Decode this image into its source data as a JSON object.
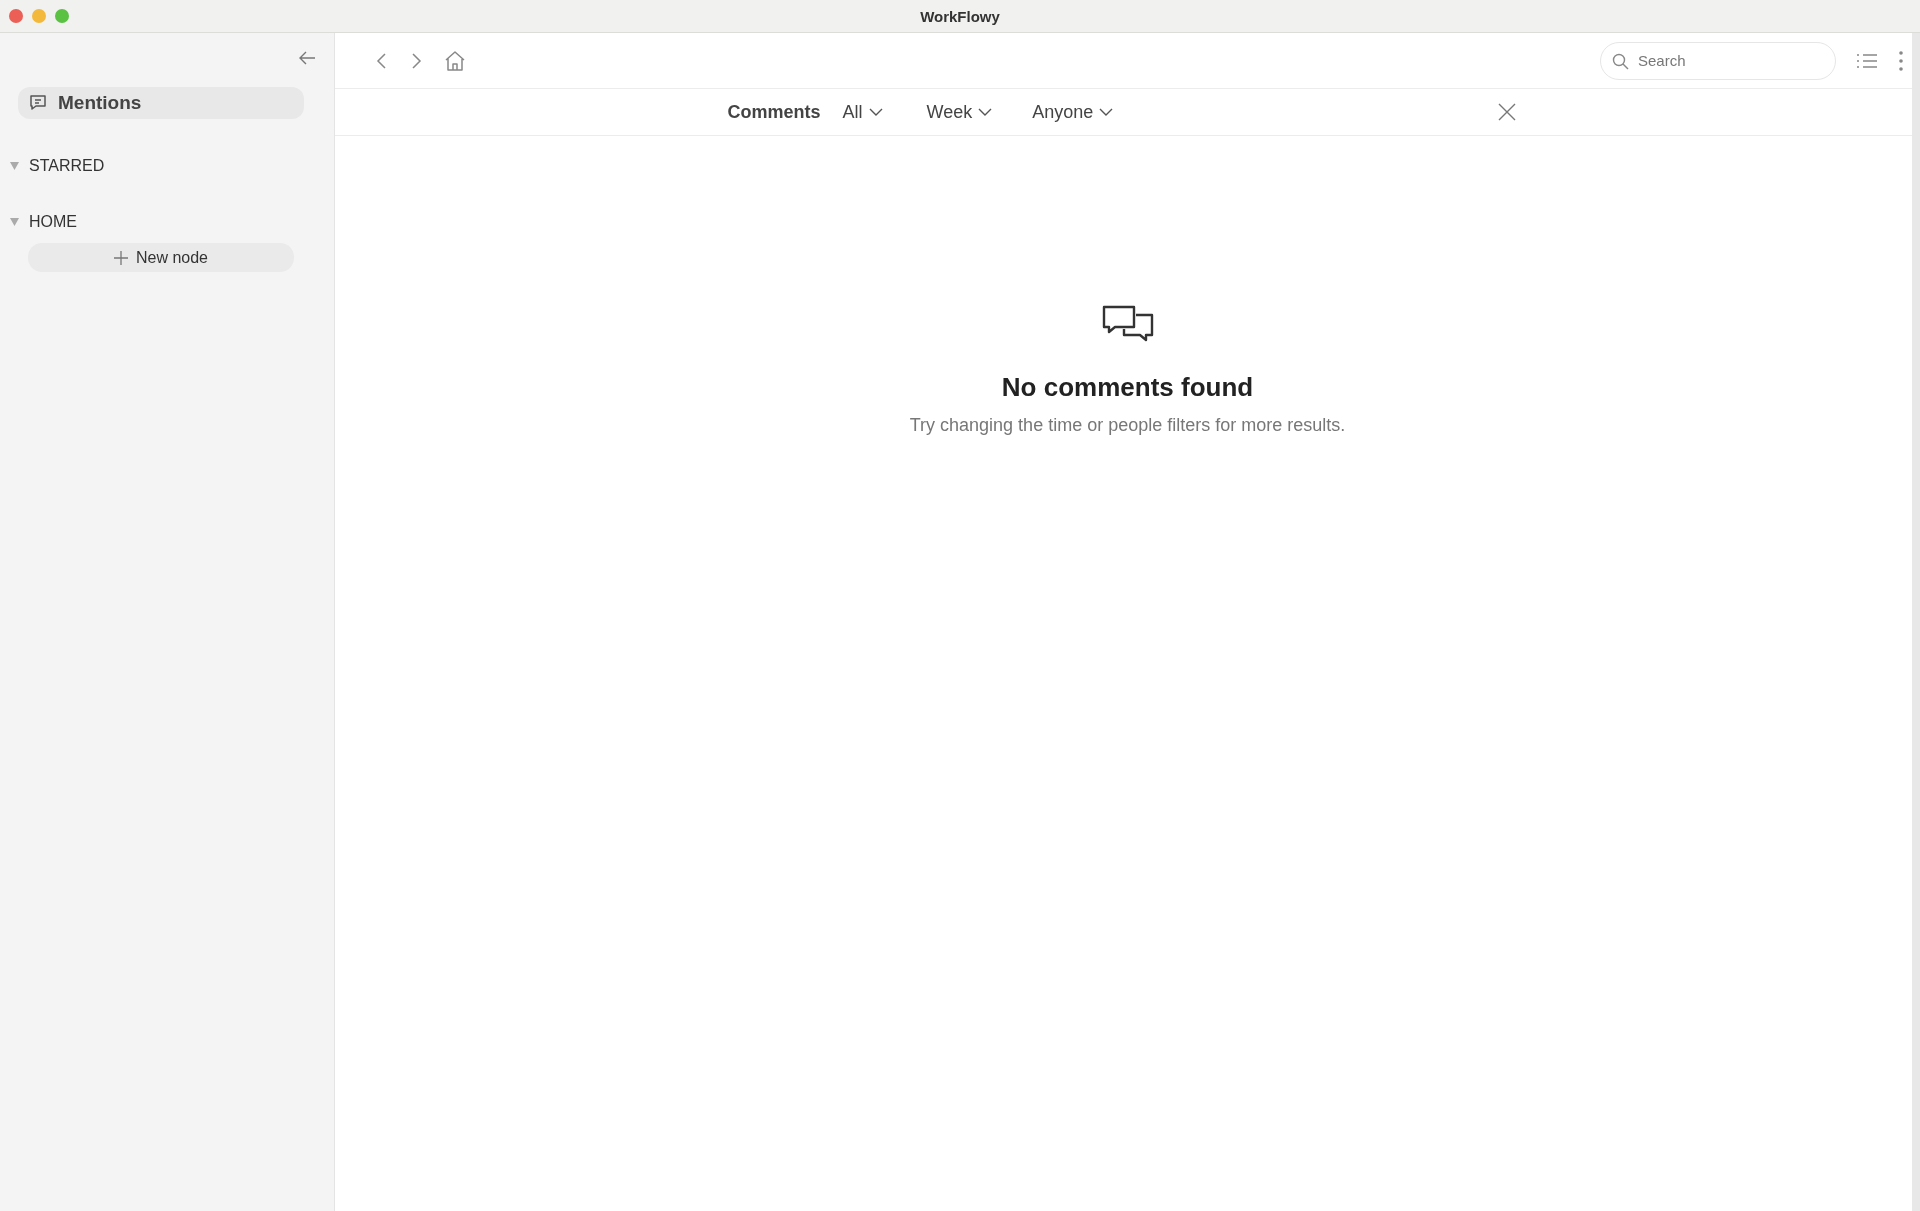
{
  "window": {
    "title": "WorkFlowy"
  },
  "sidebar": {
    "mentions": {
      "label": "Mentions",
      "selected": true
    },
    "sections": [
      {
        "label": "STARRED",
        "expanded": true
      },
      {
        "label": "HOME",
        "expanded": true,
        "new_node": "New node"
      }
    ]
  },
  "toolbar": {
    "search": {
      "placeholder": "Search"
    }
  },
  "filter_bar": {
    "title": "Comments",
    "filters": [
      {
        "label": "All"
      },
      {
        "label": "Week"
      },
      {
        "label": "Anyone"
      }
    ]
  },
  "empty_state": {
    "title": "No comments found",
    "message": "Try changing the time or people filters for more results."
  }
}
